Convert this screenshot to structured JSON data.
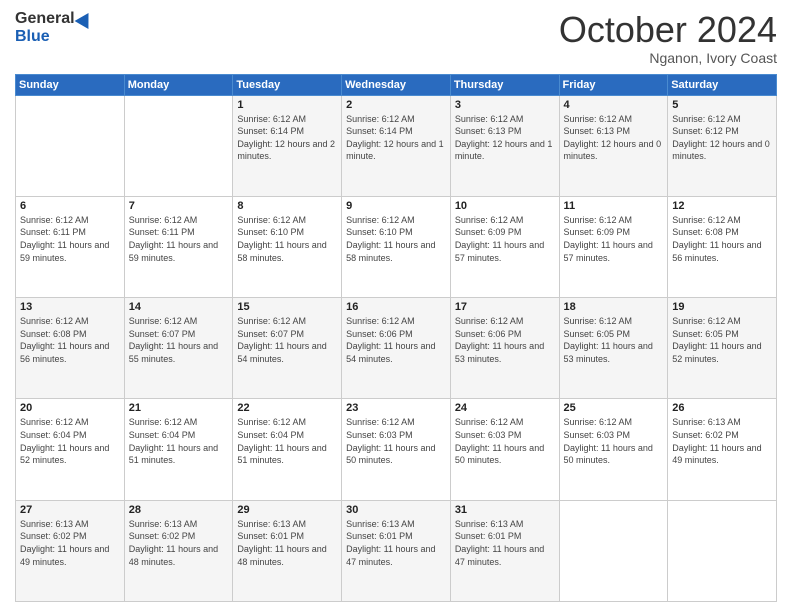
{
  "header": {
    "logo_general": "General",
    "logo_blue": "Blue",
    "title": "October 2024",
    "location": "Nganon, Ivory Coast"
  },
  "weekdays": [
    "Sunday",
    "Monday",
    "Tuesday",
    "Wednesday",
    "Thursday",
    "Friday",
    "Saturday"
  ],
  "weeks": [
    [
      {
        "day": "",
        "info": ""
      },
      {
        "day": "",
        "info": ""
      },
      {
        "day": "1",
        "info": "Sunrise: 6:12 AM\nSunset: 6:14 PM\nDaylight: 12 hours and 2 minutes."
      },
      {
        "day": "2",
        "info": "Sunrise: 6:12 AM\nSunset: 6:14 PM\nDaylight: 12 hours and 1 minute."
      },
      {
        "day": "3",
        "info": "Sunrise: 6:12 AM\nSunset: 6:13 PM\nDaylight: 12 hours and 1 minute."
      },
      {
        "day": "4",
        "info": "Sunrise: 6:12 AM\nSunset: 6:13 PM\nDaylight: 12 hours and 0 minutes."
      },
      {
        "day": "5",
        "info": "Sunrise: 6:12 AM\nSunset: 6:12 PM\nDaylight: 12 hours and 0 minutes."
      }
    ],
    [
      {
        "day": "6",
        "info": "Sunrise: 6:12 AM\nSunset: 6:11 PM\nDaylight: 11 hours and 59 minutes."
      },
      {
        "day": "7",
        "info": "Sunrise: 6:12 AM\nSunset: 6:11 PM\nDaylight: 11 hours and 59 minutes."
      },
      {
        "day": "8",
        "info": "Sunrise: 6:12 AM\nSunset: 6:10 PM\nDaylight: 11 hours and 58 minutes."
      },
      {
        "day": "9",
        "info": "Sunrise: 6:12 AM\nSunset: 6:10 PM\nDaylight: 11 hours and 58 minutes."
      },
      {
        "day": "10",
        "info": "Sunrise: 6:12 AM\nSunset: 6:09 PM\nDaylight: 11 hours and 57 minutes."
      },
      {
        "day": "11",
        "info": "Sunrise: 6:12 AM\nSunset: 6:09 PM\nDaylight: 11 hours and 57 minutes."
      },
      {
        "day": "12",
        "info": "Sunrise: 6:12 AM\nSunset: 6:08 PM\nDaylight: 11 hours and 56 minutes."
      }
    ],
    [
      {
        "day": "13",
        "info": "Sunrise: 6:12 AM\nSunset: 6:08 PM\nDaylight: 11 hours and 56 minutes."
      },
      {
        "day": "14",
        "info": "Sunrise: 6:12 AM\nSunset: 6:07 PM\nDaylight: 11 hours and 55 minutes."
      },
      {
        "day": "15",
        "info": "Sunrise: 6:12 AM\nSunset: 6:07 PM\nDaylight: 11 hours and 54 minutes."
      },
      {
        "day": "16",
        "info": "Sunrise: 6:12 AM\nSunset: 6:06 PM\nDaylight: 11 hours and 54 minutes."
      },
      {
        "day": "17",
        "info": "Sunrise: 6:12 AM\nSunset: 6:06 PM\nDaylight: 11 hours and 53 minutes."
      },
      {
        "day": "18",
        "info": "Sunrise: 6:12 AM\nSunset: 6:05 PM\nDaylight: 11 hours and 53 minutes."
      },
      {
        "day": "19",
        "info": "Sunrise: 6:12 AM\nSunset: 6:05 PM\nDaylight: 11 hours and 52 minutes."
      }
    ],
    [
      {
        "day": "20",
        "info": "Sunrise: 6:12 AM\nSunset: 6:04 PM\nDaylight: 11 hours and 52 minutes."
      },
      {
        "day": "21",
        "info": "Sunrise: 6:12 AM\nSunset: 6:04 PM\nDaylight: 11 hours and 51 minutes."
      },
      {
        "day": "22",
        "info": "Sunrise: 6:12 AM\nSunset: 6:04 PM\nDaylight: 11 hours and 51 minutes."
      },
      {
        "day": "23",
        "info": "Sunrise: 6:12 AM\nSunset: 6:03 PM\nDaylight: 11 hours and 50 minutes."
      },
      {
        "day": "24",
        "info": "Sunrise: 6:12 AM\nSunset: 6:03 PM\nDaylight: 11 hours and 50 minutes."
      },
      {
        "day": "25",
        "info": "Sunrise: 6:12 AM\nSunset: 6:03 PM\nDaylight: 11 hours and 50 minutes."
      },
      {
        "day": "26",
        "info": "Sunrise: 6:13 AM\nSunset: 6:02 PM\nDaylight: 11 hours and 49 minutes."
      }
    ],
    [
      {
        "day": "27",
        "info": "Sunrise: 6:13 AM\nSunset: 6:02 PM\nDaylight: 11 hours and 49 minutes."
      },
      {
        "day": "28",
        "info": "Sunrise: 6:13 AM\nSunset: 6:02 PM\nDaylight: 11 hours and 48 minutes."
      },
      {
        "day": "29",
        "info": "Sunrise: 6:13 AM\nSunset: 6:01 PM\nDaylight: 11 hours and 48 minutes."
      },
      {
        "day": "30",
        "info": "Sunrise: 6:13 AM\nSunset: 6:01 PM\nDaylight: 11 hours and 47 minutes."
      },
      {
        "day": "31",
        "info": "Sunrise: 6:13 AM\nSunset: 6:01 PM\nDaylight: 11 hours and 47 minutes."
      },
      {
        "day": "",
        "info": ""
      },
      {
        "day": "",
        "info": ""
      }
    ]
  ]
}
